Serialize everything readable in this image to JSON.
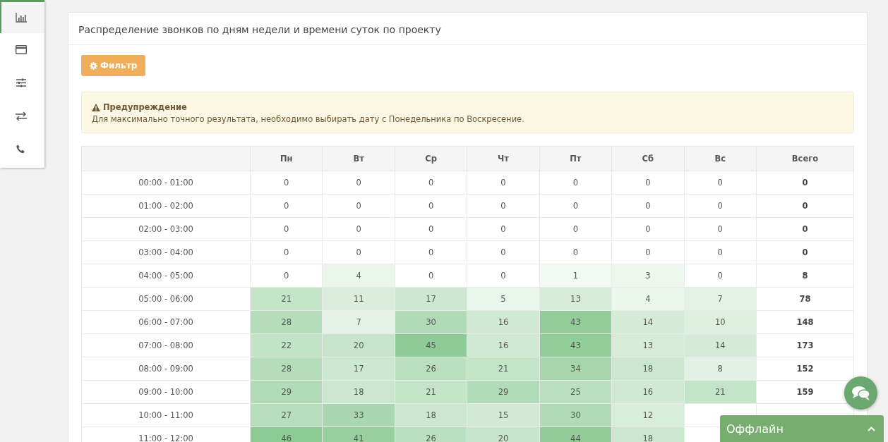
{
  "sidebar": {
    "items": [
      {
        "selected": true
      },
      {
        "selected": false
      },
      {
        "selected": false
      },
      {
        "selected": false
      },
      {
        "selected": false
      }
    ]
  },
  "card": {
    "title": "Распределение звонков по дням недели и времени суток по проекту",
    "filter_button": "Фильтр",
    "alert": {
      "title": "Предупреждение",
      "text": "Для максимально точного результата, необходимо выбирать дату с Понедельника по Воскресение."
    },
    "table": {
      "columns": [
        "",
        "Пн",
        "Вт",
        "Ср",
        "Чт",
        "Пт",
        "Сб",
        "Вс",
        "Всего"
      ],
      "rows": [
        {
          "time": "00:00 - 01:00",
          "values": [
            "0",
            "0",
            "0",
            "0",
            "0",
            "0",
            "0"
          ],
          "total": "0"
        },
        {
          "time": "01:00 - 02:00",
          "values": [
            "0",
            "0",
            "0",
            "0",
            "0",
            "0",
            "0"
          ],
          "total": "0"
        },
        {
          "time": "02:00 - 03:00",
          "values": [
            "0",
            "0",
            "0",
            "0",
            "0",
            "0",
            "0"
          ],
          "total": "0"
        },
        {
          "time": "03:00 - 04:00",
          "values": [
            "0",
            "0",
            "0",
            "0",
            "0",
            "0",
            "0"
          ],
          "total": "0"
        },
        {
          "time": "04:00 - 05:00",
          "values": [
            "0",
            "4",
            "0",
            "0",
            "1",
            "3",
            "0"
          ],
          "total": "8"
        },
        {
          "time": "05:00 - 06:00",
          "values": [
            "21",
            "11",
            "17",
            "5",
            "13",
            "4",
            "7"
          ],
          "total": "78"
        },
        {
          "time": "06:00 - 07:00",
          "values": [
            "28",
            "7",
            "30",
            "16",
            "43",
            "14",
            "10"
          ],
          "total": "148"
        },
        {
          "time": "07:00 - 08:00",
          "values": [
            "22",
            "20",
            "45",
            "16",
            "43",
            "13",
            "14"
          ],
          "total": "173"
        },
        {
          "time": "08:00 - 09:00",
          "values": [
            "28",
            "17",
            "26",
            "21",
            "34",
            "18",
            "8"
          ],
          "total": "152"
        },
        {
          "time": "09:00 - 10:00",
          "values": [
            "29",
            "18",
            "21",
            "29",
            "25",
            "16",
            "21"
          ],
          "total": "159"
        },
        {
          "time": "10:00 - 11:00",
          "values": [
            "27",
            "33",
            "18",
            "15",
            "30",
            "12"
          ]
        },
        {
          "time": "11:00 - 12:00",
          "values": [
            "46",
            "41",
            "26",
            "20",
            "44",
            "18"
          ]
        }
      ]
    }
  },
  "chat": {
    "status": "Оффлайн"
  }
}
